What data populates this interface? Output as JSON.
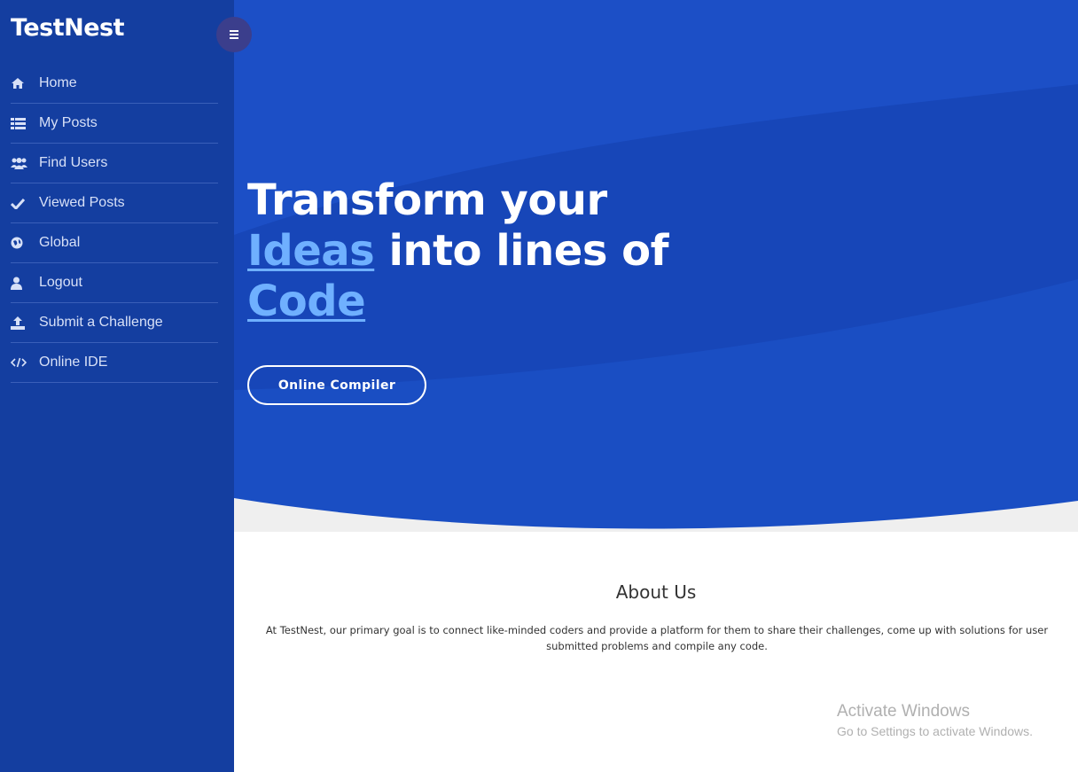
{
  "brand": {
    "name": "TestNest"
  },
  "colors": {
    "sidebar": "#143ea0",
    "hero": "#1c4fc6",
    "accent": "#6fb0ff"
  },
  "sidebar": {
    "items": [
      {
        "label": "Home",
        "icon": "home-icon"
      },
      {
        "label": "My Posts",
        "icon": "list-icon"
      },
      {
        "label": "Find Users",
        "icon": "users-icon"
      },
      {
        "label": "Viewed Posts",
        "icon": "check-icon"
      },
      {
        "label": "Global",
        "icon": "globe-icon"
      },
      {
        "label": "Logout",
        "icon": "user-icon"
      },
      {
        "label": "Submit a Challenge",
        "icon": "upload-icon"
      },
      {
        "label": "Online IDE",
        "icon": "code-icon"
      }
    ]
  },
  "toggle": {
    "icon": "menu-icon"
  },
  "hero": {
    "line1": "Transform your",
    "highlight1": "Ideas",
    "line2_rest": " into lines of",
    "highlight2": "Code",
    "button_label": "Online Compiler"
  },
  "about": {
    "title": "About Us",
    "text": "At TestNest, our primary goal is to connect like-minded coders and provide a platform for them to share their challenges, come up with solutions for user submitted problems and compile any code."
  },
  "watermark": {
    "title": "Activate Windows",
    "subtitle": "Go to Settings to activate Windows."
  }
}
